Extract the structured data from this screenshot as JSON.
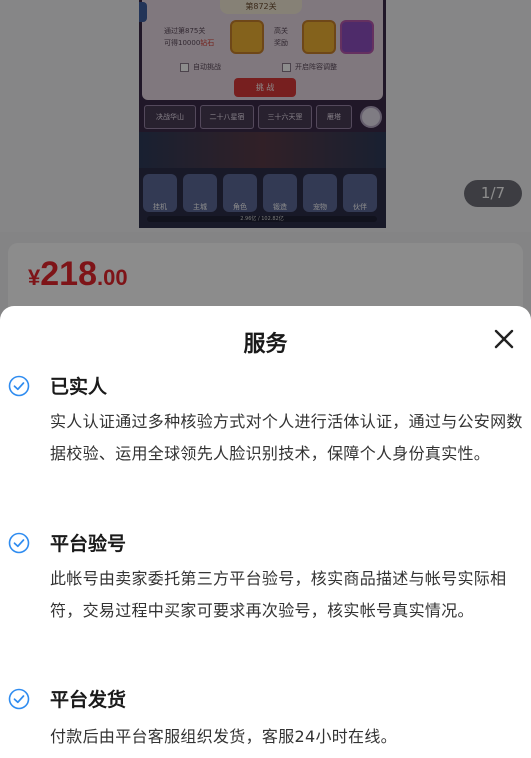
{
  "carousel": {
    "pager": "1/7",
    "game": {
      "stage": "第872关",
      "reward_line1": "通过第875关",
      "reward_line2_prefix": "可得10000",
      "reward_line2_red": "钻石",
      "reward_mid_line1": "高关",
      "reward_mid_line2": "奖励",
      "auto_fight": "自动挑战",
      "auto_adjust": "开启阵容调整",
      "start": "挑 战",
      "tabs": [
        "决战华山",
        "二十八星宿",
        "三十六天罡",
        "雁塔"
      ],
      "nav": [
        "挂机",
        "主城",
        "角色",
        "锻造",
        "宠物",
        "伙伴"
      ],
      "progress": "2.96亿 / 102.82亿"
    }
  },
  "price": {
    "currency": "¥",
    "integer": "218",
    "decimal": ".00"
  },
  "sheet": {
    "title": "服务",
    "items": [
      {
        "name": "已实人",
        "desc": "实人认证通过多种核验方式对个人进行活体认证，通过与公安网数据校验、运用全球领先人脸识别技术，保障个人身份真实性。"
      },
      {
        "name": "平台验号",
        "desc": "此帐号由卖家委托第三方平台验号，核实商品描述与帐号实际相符，交易过程中买家可要求再次验号，核实帐号真实情况。"
      },
      {
        "name": "平台发货",
        "desc": "付款后由平台客服组织发货，客服24小时在线。"
      }
    ]
  },
  "colors": {
    "accent_blue": "#2f8cf0",
    "price_red": "#e5262c"
  }
}
